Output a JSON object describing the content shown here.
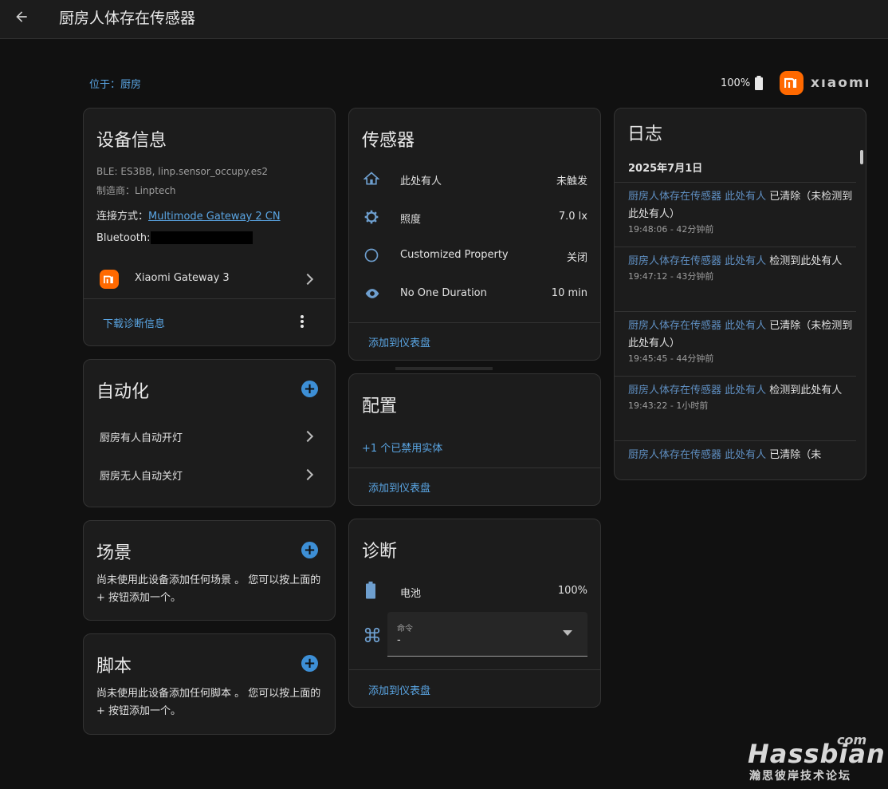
{
  "header": {
    "title": "厨房人体存在传感器"
  },
  "location": "位于：厨房",
  "battery_top": "100%",
  "brand": "xıaomı",
  "device_info": {
    "title": "设备信息",
    "model": "BLE: ES3BB, linp.sensor_occupy.es2",
    "manufacturer": "制造商：Linptech",
    "connection_label": "连接方式：",
    "connection_link": "Multimode Gateway 2 CN",
    "bluetooth_label": "Bluetooth:",
    "gateway_name": "Xiaomi Gateway 3",
    "download": "下载诊断信息"
  },
  "automation": {
    "title": "自动化",
    "items": [
      "厨房有人自动开灯",
      "厨房无人自动关灯"
    ]
  },
  "scene": {
    "title": "场景",
    "text": "尚未使用此设备添加任何场景 。 您可以按上面的 + 按钮添加一个。"
  },
  "script": {
    "title": "脚本",
    "text": "尚未使用此设备添加任何脚本 。 您可以按上面的 + 按钮添加一个。"
  },
  "sensors": {
    "title": "传感器",
    "rows": [
      {
        "icon": "home-icon",
        "label": "此处有人",
        "value": "未触发"
      },
      {
        "icon": "gear-icon",
        "label": "照度",
        "value": "7.0 lx"
      },
      {
        "icon": "circle-icon",
        "label": "Customized Property",
        "value": "关闭"
      },
      {
        "icon": "eye-icon",
        "label": "No One Duration",
        "value": "10 min"
      }
    ],
    "add": "添加到仪表盘"
  },
  "config": {
    "title": "配置",
    "disabled": "+1 个已禁用实体",
    "add": "添加到仪表盘"
  },
  "diagnostics": {
    "title": "诊断",
    "battery_label": "电池",
    "battery_value": "100%",
    "command_label": "命令",
    "command_value": "-",
    "add": "添加到仪表盘"
  },
  "log": {
    "title": "日志",
    "date": "2025年7月1日",
    "entries": [
      {
        "link": "厨房人体存在传感器 此处有人",
        "text": " 已清除（未检测到此处有人）",
        "time": "19:48:06 - 42分钟前"
      },
      {
        "link": "厨房人体存在传感器 此处有人",
        "text": " 检测到此处有人",
        "time": "19:47:12 - 43分钟前"
      },
      {
        "link": "厨房人体存在传感器 此处有人",
        "text": " 已清除（未检测到此处有人）",
        "time": "19:45:45 - 44分钟前"
      },
      {
        "link": "厨房人体存在传感器 此处有人",
        "text": " 检测到此处有人",
        "time": "19:43:22 - 1小时前"
      },
      {
        "link": "厨房人体存在传感器 此处有人",
        "text": " 已清除（未",
        "time": ""
      }
    ]
  },
  "watermark": {
    "com": "com",
    "main": "Hassbian",
    "sub": "瀚思彼岸技术论坛"
  }
}
